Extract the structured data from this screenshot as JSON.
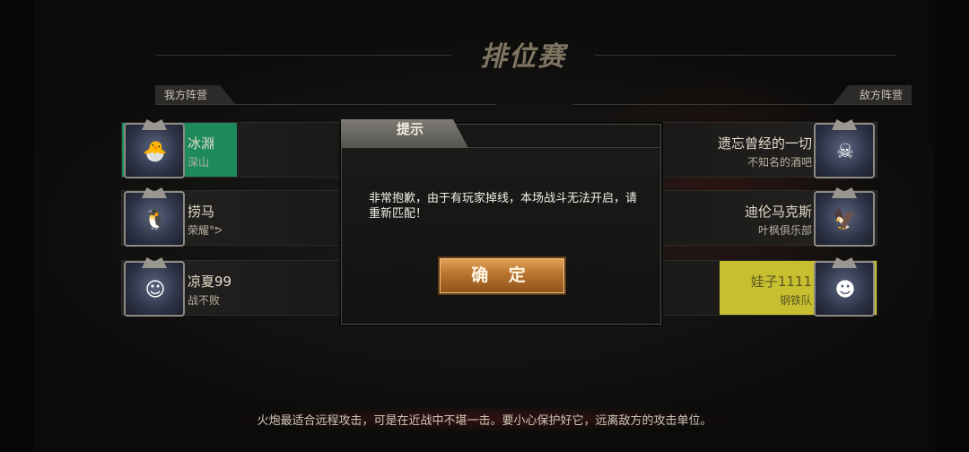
{
  "page_title": "排位赛",
  "our_team_label": "我方阵营",
  "enemy_team_label": "敌方阵营",
  "our_players": [
    {
      "name": "冰淵",
      "team": "深山",
      "avatar_icon": "chick-avatar-icon",
      "face": "🐣"
    },
    {
      "name": "捞马",
      "team": "荣耀°ᕗ",
      "avatar_icon": "qq-penguin-avatar-icon",
      "face": "🐧"
    },
    {
      "name": "凉夏99",
      "team": "战不败",
      "avatar_icon": "portrait-avatar-icon",
      "face": "☺"
    }
  ],
  "enemy_players": [
    {
      "name": "遗忘曾经的一切",
      "team": "不知名的酒吧",
      "avatar_icon": "creature-avatar-icon",
      "face": "☠"
    },
    {
      "name": "迪伦马克斯",
      "team": "叶枫俱乐部",
      "avatar_icon": "eagle-avatar-icon",
      "face": "🦅"
    },
    {
      "name": "娃子1111",
      "team": "钢铁队",
      "avatar_icon": "kids-photo-avatar-icon",
      "face": "☻"
    }
  ],
  "dialog": {
    "title": "提示",
    "message": "非常抱歉，由于有玩家掉线，本场战斗无法开启，请重新匹配！",
    "confirm_label": "确 定"
  },
  "tip_text": "火炮最适合远程攻击，可是在近战中不堪一击。要小心保护好它，远离敌方的攻击单位。",
  "colors": {
    "highlight_self": "#1e8a5b",
    "highlight_enemy": "#c7bf2f",
    "button_gold": "#b8732e"
  }
}
